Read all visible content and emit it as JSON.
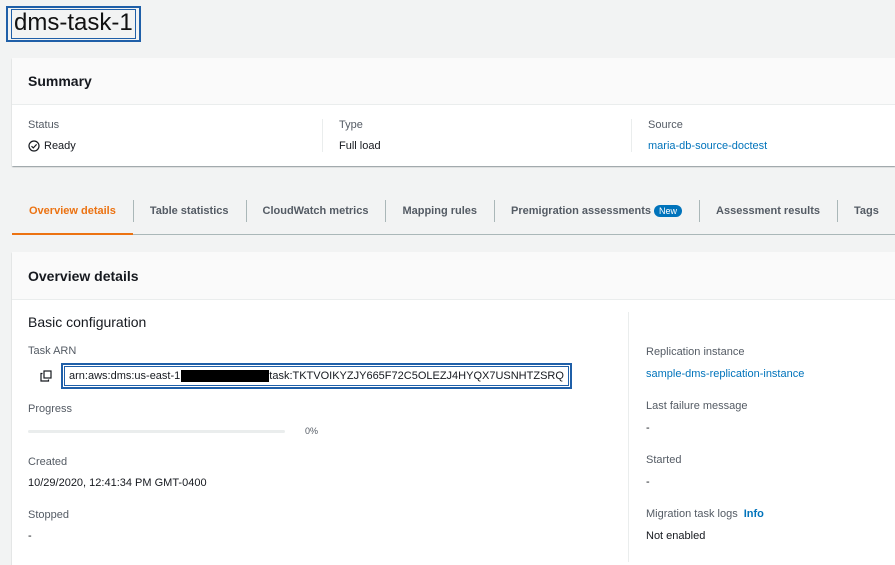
{
  "page": {
    "title": "dms-task-1"
  },
  "summary": {
    "header": "Summary",
    "status_label": "Status",
    "status_value": "Ready",
    "type_label": "Type",
    "type_value": "Full load",
    "source_label": "Source",
    "source_value": "maria-db-source-doctest"
  },
  "tabs": [
    {
      "label": "Overview details",
      "active": true
    },
    {
      "label": "Table statistics"
    },
    {
      "label": "CloudWatch metrics"
    },
    {
      "label": "Mapping rules"
    },
    {
      "label": "Premigration assessments",
      "badge": "New"
    },
    {
      "label": "Assessment results"
    },
    {
      "label": "Tags"
    }
  ],
  "overview": {
    "header": "Overview details",
    "section_title": "Basic configuration",
    "task_arn_label": "Task ARN",
    "task_arn_prefix": "arn:aws:dms:us-east-1",
    "task_arn_suffix": "task:TKTVOIKYZJY665F72C5OLEZJ4HYQX7USNHTZSRQ",
    "progress_label": "Progress",
    "progress_percent": 0,
    "progress_text": "0%",
    "created_label": "Created",
    "created_value": "10/29/2020, 12:41:34 PM GMT-0400",
    "stopped_label": "Stopped",
    "stopped_value": "-",
    "replication_label": "Replication instance",
    "replication_value": "sample-dms-replication-instance",
    "last_failure_label": "Last failure message",
    "last_failure_value": "-",
    "started_label": "Started",
    "started_value": "-",
    "logs_label": "Migration task logs",
    "logs_info": "Info",
    "logs_value": "Not enabled"
  },
  "colors": {
    "accent": "#ec7211",
    "link": "#0073bb",
    "highlight_box": "#1f5fa8"
  }
}
